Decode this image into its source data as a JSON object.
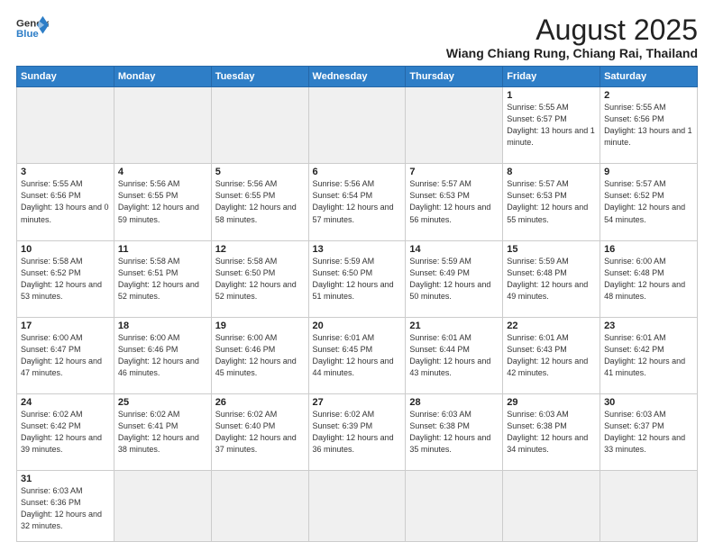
{
  "header": {
    "logo_line1": "General",
    "logo_line2": "Blue",
    "month": "August 2025",
    "location": "Wiang Chiang Rung, Chiang Rai, Thailand"
  },
  "days_of_week": [
    "Sunday",
    "Monday",
    "Tuesday",
    "Wednesday",
    "Thursday",
    "Friday",
    "Saturday"
  ],
  "weeks": [
    [
      {
        "num": "",
        "info": ""
      },
      {
        "num": "",
        "info": ""
      },
      {
        "num": "",
        "info": ""
      },
      {
        "num": "",
        "info": ""
      },
      {
        "num": "",
        "info": ""
      },
      {
        "num": "1",
        "info": "Sunrise: 5:55 AM\nSunset: 6:57 PM\nDaylight: 13 hours\nand 1 minute."
      },
      {
        "num": "2",
        "info": "Sunrise: 5:55 AM\nSunset: 6:56 PM\nDaylight: 13 hours\nand 1 minute."
      }
    ],
    [
      {
        "num": "3",
        "info": "Sunrise: 5:55 AM\nSunset: 6:56 PM\nDaylight: 13 hours\nand 0 minutes."
      },
      {
        "num": "4",
        "info": "Sunrise: 5:56 AM\nSunset: 6:55 PM\nDaylight: 12 hours\nand 59 minutes."
      },
      {
        "num": "5",
        "info": "Sunrise: 5:56 AM\nSunset: 6:55 PM\nDaylight: 12 hours\nand 58 minutes."
      },
      {
        "num": "6",
        "info": "Sunrise: 5:56 AM\nSunset: 6:54 PM\nDaylight: 12 hours\nand 57 minutes."
      },
      {
        "num": "7",
        "info": "Sunrise: 5:57 AM\nSunset: 6:53 PM\nDaylight: 12 hours\nand 56 minutes."
      },
      {
        "num": "8",
        "info": "Sunrise: 5:57 AM\nSunset: 6:53 PM\nDaylight: 12 hours\nand 55 minutes."
      },
      {
        "num": "9",
        "info": "Sunrise: 5:57 AM\nSunset: 6:52 PM\nDaylight: 12 hours\nand 54 minutes."
      }
    ],
    [
      {
        "num": "10",
        "info": "Sunrise: 5:58 AM\nSunset: 6:52 PM\nDaylight: 12 hours\nand 53 minutes."
      },
      {
        "num": "11",
        "info": "Sunrise: 5:58 AM\nSunset: 6:51 PM\nDaylight: 12 hours\nand 52 minutes."
      },
      {
        "num": "12",
        "info": "Sunrise: 5:58 AM\nSunset: 6:50 PM\nDaylight: 12 hours\nand 52 minutes."
      },
      {
        "num": "13",
        "info": "Sunrise: 5:59 AM\nSunset: 6:50 PM\nDaylight: 12 hours\nand 51 minutes."
      },
      {
        "num": "14",
        "info": "Sunrise: 5:59 AM\nSunset: 6:49 PM\nDaylight: 12 hours\nand 50 minutes."
      },
      {
        "num": "15",
        "info": "Sunrise: 5:59 AM\nSunset: 6:48 PM\nDaylight: 12 hours\nand 49 minutes."
      },
      {
        "num": "16",
        "info": "Sunrise: 6:00 AM\nSunset: 6:48 PM\nDaylight: 12 hours\nand 48 minutes."
      }
    ],
    [
      {
        "num": "17",
        "info": "Sunrise: 6:00 AM\nSunset: 6:47 PM\nDaylight: 12 hours\nand 47 minutes."
      },
      {
        "num": "18",
        "info": "Sunrise: 6:00 AM\nSunset: 6:46 PM\nDaylight: 12 hours\nand 46 minutes."
      },
      {
        "num": "19",
        "info": "Sunrise: 6:00 AM\nSunset: 6:46 PM\nDaylight: 12 hours\nand 45 minutes."
      },
      {
        "num": "20",
        "info": "Sunrise: 6:01 AM\nSunset: 6:45 PM\nDaylight: 12 hours\nand 44 minutes."
      },
      {
        "num": "21",
        "info": "Sunrise: 6:01 AM\nSunset: 6:44 PM\nDaylight: 12 hours\nand 43 minutes."
      },
      {
        "num": "22",
        "info": "Sunrise: 6:01 AM\nSunset: 6:43 PM\nDaylight: 12 hours\nand 42 minutes."
      },
      {
        "num": "23",
        "info": "Sunrise: 6:01 AM\nSunset: 6:42 PM\nDaylight: 12 hours\nand 41 minutes."
      }
    ],
    [
      {
        "num": "24",
        "info": "Sunrise: 6:02 AM\nSunset: 6:42 PM\nDaylight: 12 hours\nand 39 minutes."
      },
      {
        "num": "25",
        "info": "Sunrise: 6:02 AM\nSunset: 6:41 PM\nDaylight: 12 hours\nand 38 minutes."
      },
      {
        "num": "26",
        "info": "Sunrise: 6:02 AM\nSunset: 6:40 PM\nDaylight: 12 hours\nand 37 minutes."
      },
      {
        "num": "27",
        "info": "Sunrise: 6:02 AM\nSunset: 6:39 PM\nDaylight: 12 hours\nand 36 minutes."
      },
      {
        "num": "28",
        "info": "Sunrise: 6:03 AM\nSunset: 6:38 PM\nDaylight: 12 hours\nand 35 minutes."
      },
      {
        "num": "29",
        "info": "Sunrise: 6:03 AM\nSunset: 6:38 PM\nDaylight: 12 hours\nand 34 minutes."
      },
      {
        "num": "30",
        "info": "Sunrise: 6:03 AM\nSunset: 6:37 PM\nDaylight: 12 hours\nand 33 minutes."
      }
    ],
    [
      {
        "num": "31",
        "info": "Sunrise: 6:03 AM\nSunset: 6:36 PM\nDaylight: 12 hours\nand 32 minutes."
      },
      {
        "num": "",
        "info": ""
      },
      {
        "num": "",
        "info": ""
      },
      {
        "num": "",
        "info": ""
      },
      {
        "num": "",
        "info": ""
      },
      {
        "num": "",
        "info": ""
      },
      {
        "num": "",
        "info": ""
      }
    ]
  ]
}
